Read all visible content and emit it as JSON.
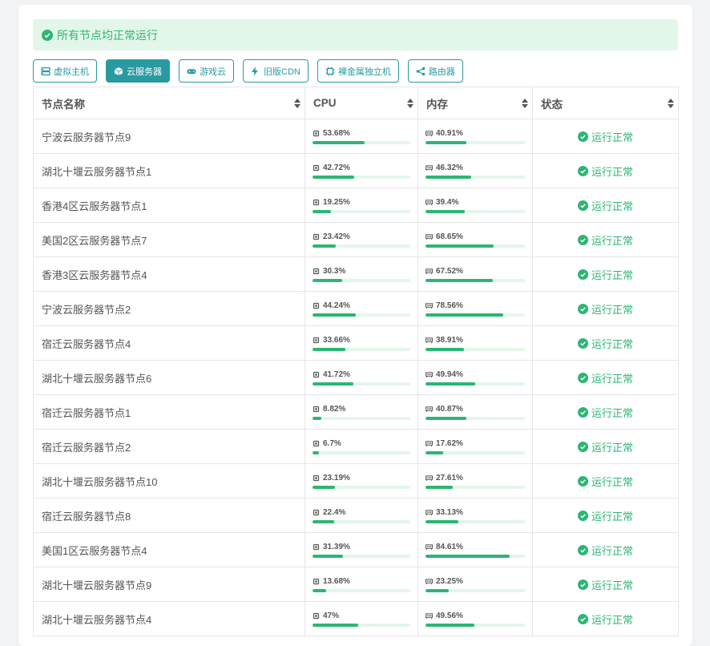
{
  "alert": {
    "text": "所有节点均正常运行"
  },
  "tabs": [
    {
      "label": "虚拟主机",
      "icon": "server-icon",
      "active": false
    },
    {
      "label": "云服务器",
      "icon": "cube-icon",
      "active": true
    },
    {
      "label": "游戏云",
      "icon": "gamepad-icon",
      "active": false
    },
    {
      "label": "旧版CDN",
      "icon": "bolt-icon",
      "active": false
    },
    {
      "label": "裸金属独立机",
      "icon": "chip-icon",
      "active": false
    },
    {
      "label": "路由器",
      "icon": "share-icon",
      "active": false
    }
  ],
  "table": {
    "headers": {
      "name": "节点名称",
      "cpu": "CPU",
      "mem": "内存",
      "status": "状态"
    },
    "rows": [
      {
        "name": "宁波云服务器节点9",
        "cpu": "53.68%",
        "cpu_pct": 53.68,
        "mem": "40.91%",
        "mem_pct": 40.91,
        "status": "运行正常"
      },
      {
        "name": "湖北十堰云服务器节点1",
        "cpu": "42.72%",
        "cpu_pct": 42.72,
        "mem": "46.32%",
        "mem_pct": 46.32,
        "status": "运行正常"
      },
      {
        "name": "香港4区云服务器节点1",
        "cpu": "19.25%",
        "cpu_pct": 19.25,
        "mem": "39.4%",
        "mem_pct": 39.4,
        "status": "运行正常"
      },
      {
        "name": "美国2区云服务器节点7",
        "cpu": "23.42%",
        "cpu_pct": 23.42,
        "mem": "68.65%",
        "mem_pct": 68.65,
        "status": "运行正常"
      },
      {
        "name": "香港3区云服务器节点4",
        "cpu": "30.3%",
        "cpu_pct": 30.3,
        "mem": "67.52%",
        "mem_pct": 67.52,
        "status": "运行正常"
      },
      {
        "name": "宁波云服务器节点2",
        "cpu": "44.24%",
        "cpu_pct": 44.24,
        "mem": "78.56%",
        "mem_pct": 78.56,
        "status": "运行正常"
      },
      {
        "name": "宿迁云服务器节点4",
        "cpu": "33.66%",
        "cpu_pct": 33.66,
        "mem": "38.91%",
        "mem_pct": 38.91,
        "status": "运行正常"
      },
      {
        "name": "湖北十堰云服务器节点6",
        "cpu": "41.72%",
        "cpu_pct": 41.72,
        "mem": "49.94%",
        "mem_pct": 49.94,
        "status": "运行正常"
      },
      {
        "name": "宿迁云服务器节点1",
        "cpu": "8.82%",
        "cpu_pct": 8.82,
        "mem": "40.87%",
        "mem_pct": 40.87,
        "status": "运行正常"
      },
      {
        "name": "宿迁云服务器节点2",
        "cpu": "6.7%",
        "cpu_pct": 6.7,
        "mem": "17.62%",
        "mem_pct": 17.62,
        "status": "运行正常"
      },
      {
        "name": "湖北十堰云服务器节点10",
        "cpu": "23.19%",
        "cpu_pct": 23.19,
        "mem": "27.61%",
        "mem_pct": 27.61,
        "status": "运行正常"
      },
      {
        "name": "宿迁云服务器节点8",
        "cpu": "22.4%",
        "cpu_pct": 22.4,
        "mem": "33.13%",
        "mem_pct": 33.13,
        "status": "运行正常"
      },
      {
        "name": "美国1区云服务器节点4",
        "cpu": "31.39%",
        "cpu_pct": 31.39,
        "mem": "84.61%",
        "mem_pct": 84.61,
        "status": "运行正常"
      },
      {
        "name": "湖北十堰云服务器节点9",
        "cpu": "13.68%",
        "cpu_pct": 13.68,
        "mem": "23.25%",
        "mem_pct": 23.25,
        "status": "运行正常"
      },
      {
        "name": "湖北十堰云服务器节点4",
        "cpu": "47%",
        "cpu_pct": 47,
        "mem": "49.56%",
        "mem_pct": 49.56,
        "status": "运行正常"
      }
    ]
  },
  "colors": {
    "accent": "#2a9aa2",
    "success": "#2bb673",
    "success_bg": "#e3f6ea"
  }
}
